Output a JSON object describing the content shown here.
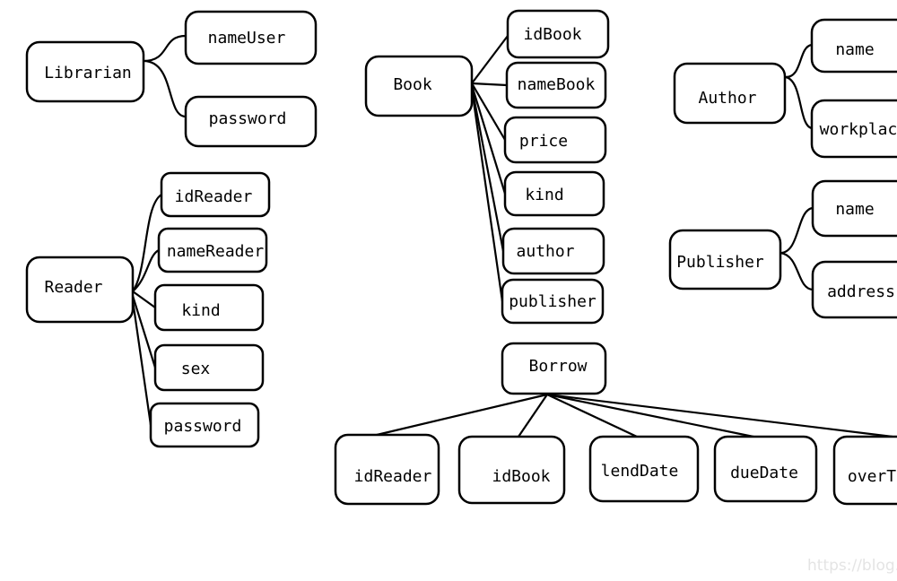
{
  "entities": {
    "librarian": {
      "name": "Librarian",
      "attributes": [
        "nameUser",
        "password"
      ]
    },
    "reader": {
      "name": "Reader",
      "attributes": [
        "idReader",
        "nameReader",
        "kind",
        "sex",
        "password"
      ]
    },
    "book": {
      "name": "Book",
      "attributes": [
        "idBook",
        "nameBook",
        "price",
        "kind",
        "author",
        "publisher"
      ]
    },
    "borrow": {
      "name": "Borrow",
      "attributes": [
        "idReader",
        "idBook",
        "lendDate",
        "dueDate",
        "overT"
      ]
    },
    "author": {
      "name": "Author",
      "attributes": [
        "name",
        "workplac"
      ]
    },
    "publisher": {
      "name": "Publisher",
      "attributes": [
        "name",
        "address"
      ]
    }
  },
  "watermark": "https://blog.cs"
}
